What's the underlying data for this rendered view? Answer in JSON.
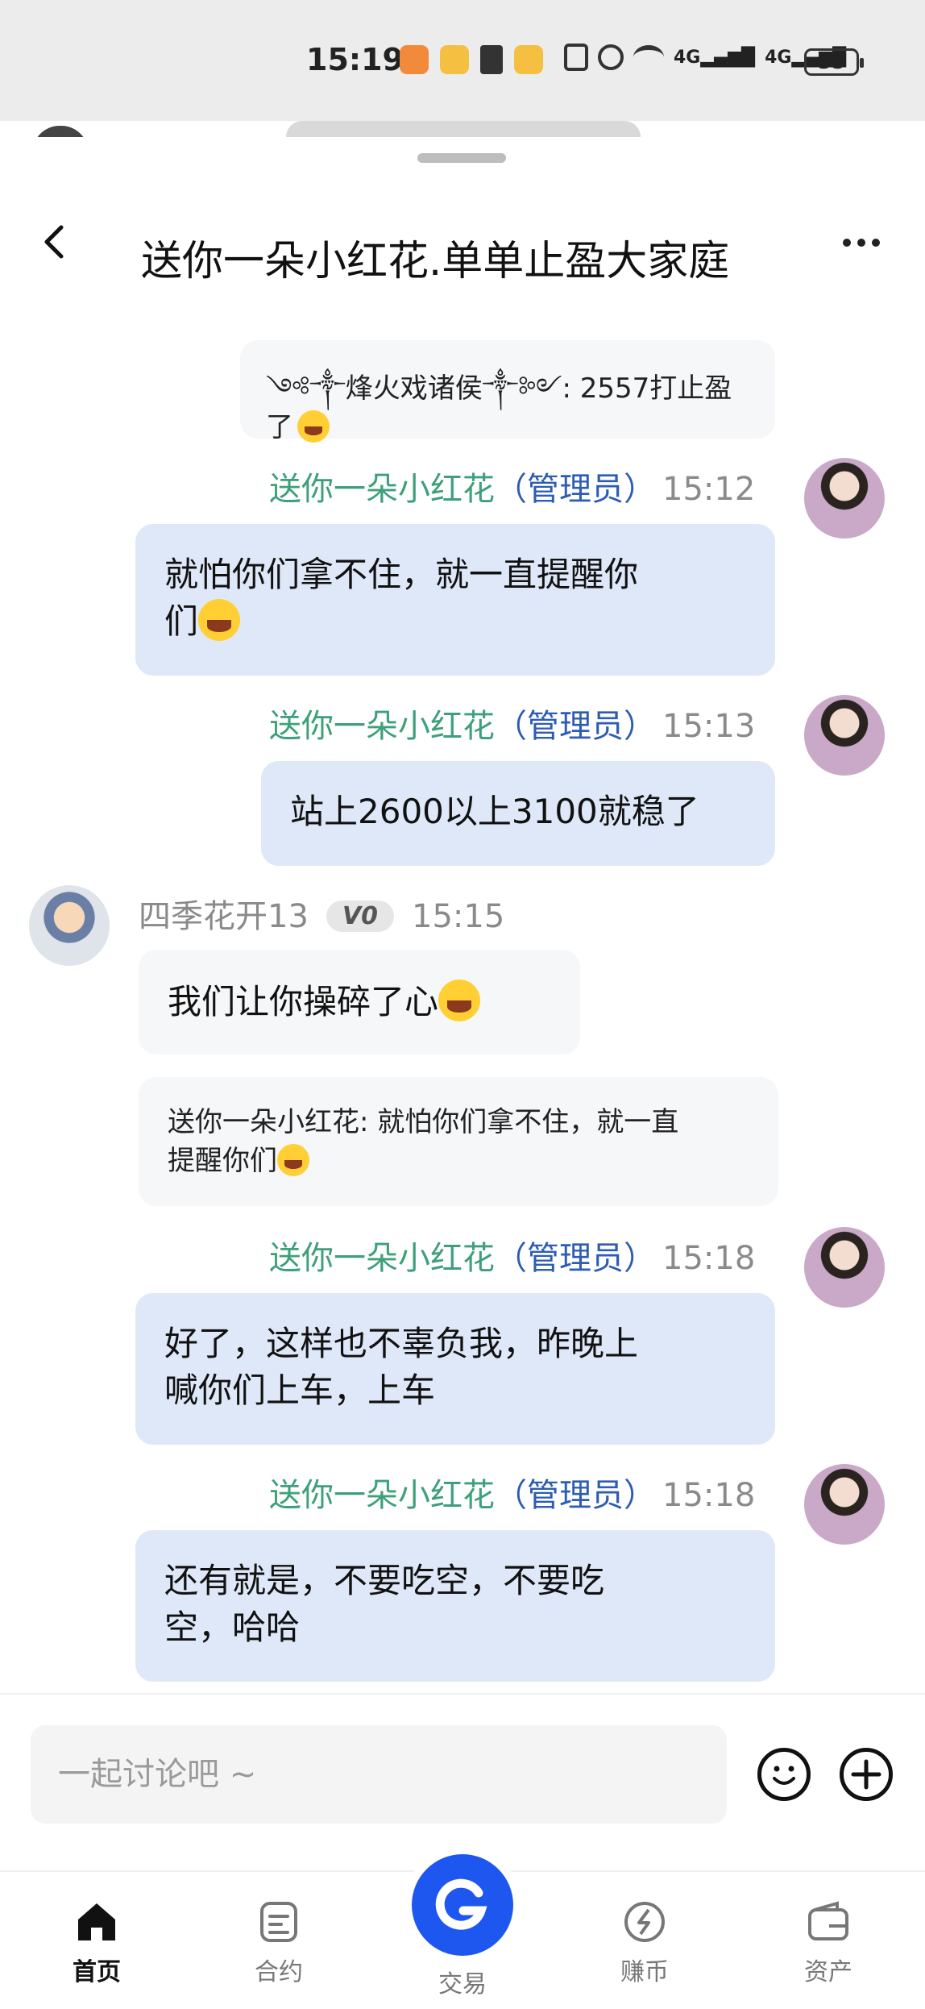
{
  "status_bar": {
    "time": "15:19",
    "network_1": "4G",
    "network_2": "4G",
    "battery": "35"
  },
  "header": {
    "title": "送你一朵小红花.单单止盈大家庭"
  },
  "messages": [
    {
      "type": "quote",
      "text": "༺༒烽火戏诸侯༒༻: 2557打止盈了"
    },
    {
      "type": "admin",
      "name": "送你一朵小红花",
      "role": "（管理员）",
      "time": "15:12",
      "text_line1": "就怕你们拿不住，就一直提醒你",
      "text_line2": "们"
    },
    {
      "type": "admin",
      "name": "送你一朵小红花",
      "role": "（管理员）",
      "time": "15:13",
      "text": "站上2600以上3100就稳了"
    },
    {
      "type": "member",
      "name": "四季花开13",
      "badge": "V0",
      "time": "15:15",
      "text": "我们让你操碎了心",
      "quote_line1": "送你一朵小红花: 就怕你们拿不住，就一直",
      "quote_line2": "提醒你们"
    },
    {
      "type": "admin",
      "name": "送你一朵小红花",
      "role": "（管理员）",
      "time": "15:18",
      "text_line1": "好了，这样也不辜负我，昨晚上",
      "text_line2": "喊你们上车，上车"
    },
    {
      "type": "admin",
      "name": "送你一朵小红花",
      "role": "（管理员）",
      "time": "15:18",
      "text_line1": "还有就是，不要吃空，不要吃",
      "text_line2": "空，哈哈"
    }
  ],
  "composer": {
    "placeholder": "一起讨论吧 ~"
  },
  "tabs": [
    {
      "label": "首页",
      "icon": "home-icon",
      "active": true
    },
    {
      "label": "合约",
      "icon": "contract-icon"
    },
    {
      "label": "交易",
      "icon": "trade-icon"
    },
    {
      "label": "赚币",
      "icon": "earn-icon"
    },
    {
      "label": "资产",
      "icon": "wallet-icon"
    }
  ],
  "colors": {
    "admin_name": "#3ea07b",
    "admin_role": "#2d5db3",
    "bubble_blue": "#dfe8f8",
    "accent": "#1e57f0"
  }
}
